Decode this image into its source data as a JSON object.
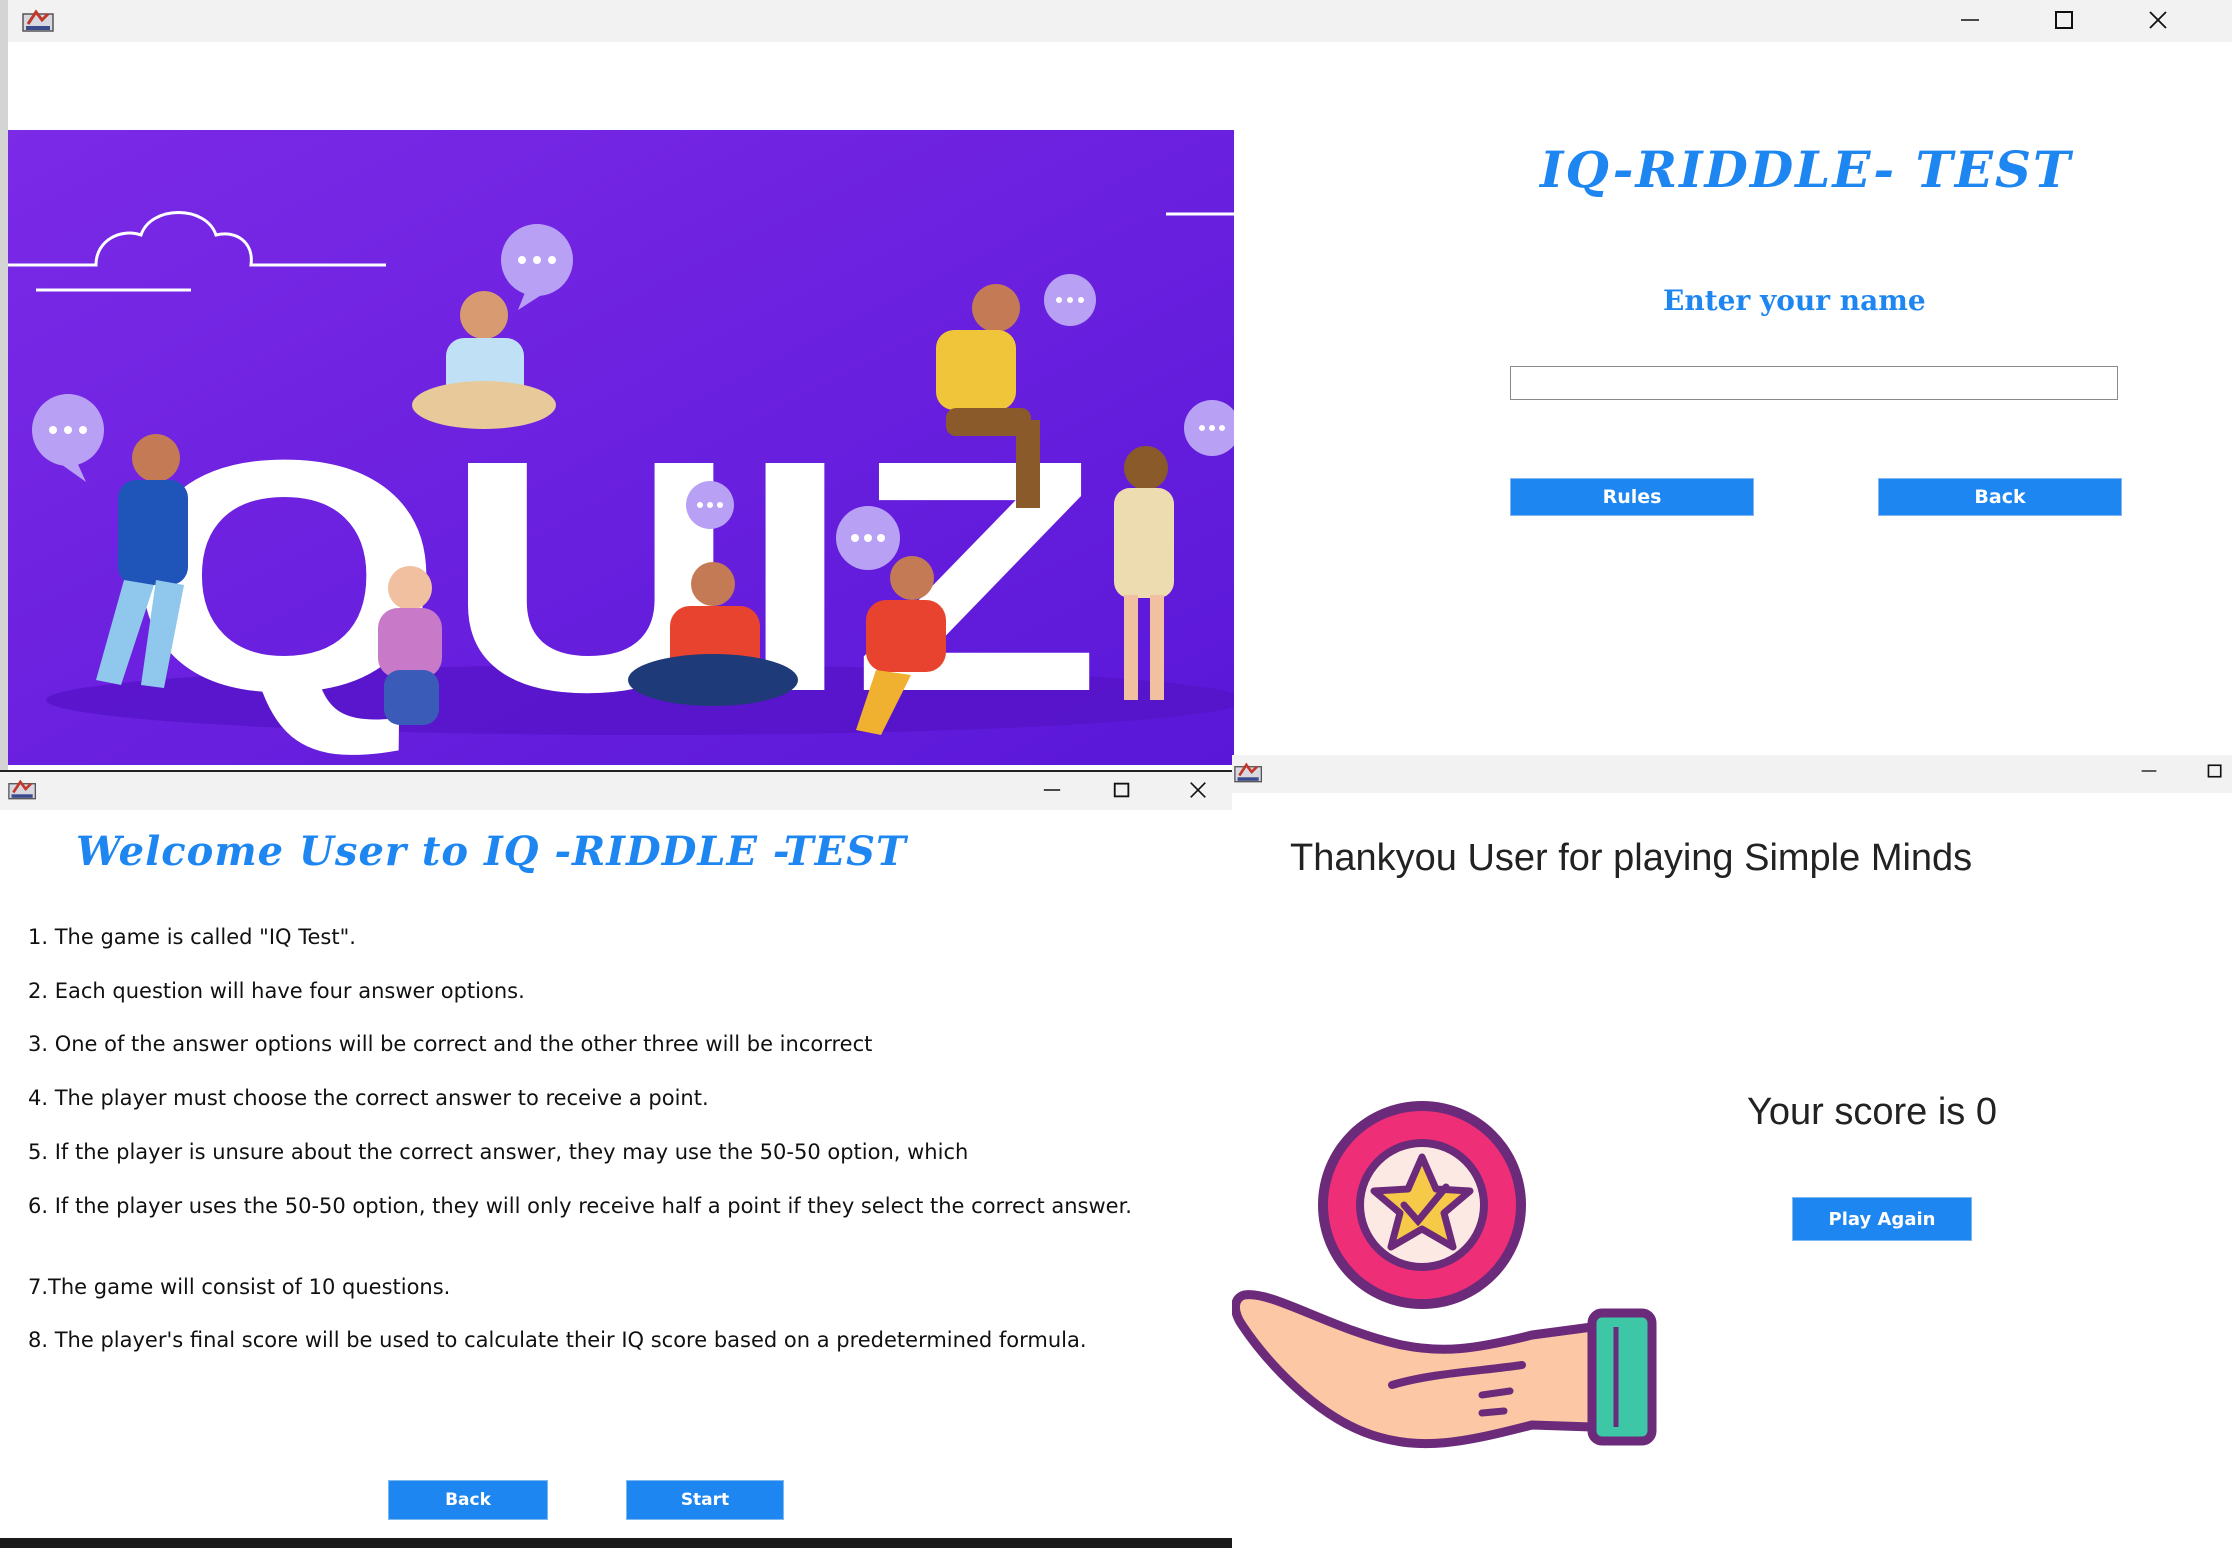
{
  "login": {
    "banner_word": "QUIZ",
    "title": "IQ-RIDDLE- TEST",
    "prompt": "Enter your name",
    "name_value": "",
    "rules_button": "Rules",
    "back_button": "Back"
  },
  "rules": {
    "heading": "Welcome User to IQ -RIDDLE -TEST",
    "items": [
      "1. The game is called \"IQ Test\".",
      "2. Each question will have four answer options.",
      "3. One of the answer options will be correct and the other three will be incorrect",
      "4. The player must choose the correct answer to receive a point.",
      "5. If the player is unsure about the correct answer, they may use the 50-50 option, which",
      "6. If the player uses the 50-50 option, they will only receive half a point if they select the correct answer.",
      "7.The game will consist of 10 questions.",
      "8. The player's final score will be used to calculate their IQ score based on a predetermined formula."
    ],
    "back_button": "Back",
    "start_button": "Start"
  },
  "score": {
    "thanks": "Thankyou User for playing Simple Minds",
    "score_text": "Your score is 0",
    "play_again_button": "Play Again"
  },
  "colors": {
    "accent": "#1e86f0",
    "banner": "#6a1fe0",
    "titlebar": "#f2f2f2"
  }
}
